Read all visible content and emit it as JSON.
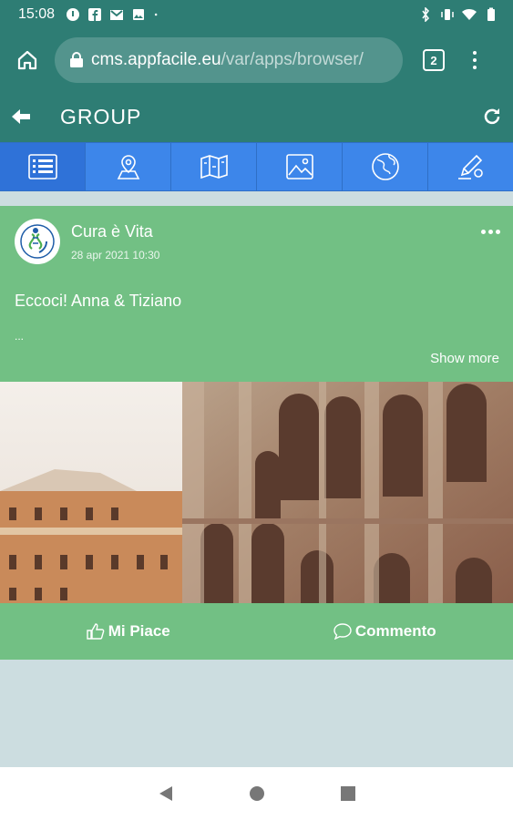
{
  "status_bar": {
    "time": "15:08",
    "left_icons": [
      "info-icon",
      "facebook-icon",
      "gmail-icon",
      "image-icon",
      "dot-icon"
    ],
    "right_icons": [
      "bluetooth-icon",
      "vibrate-icon",
      "wifi-icon",
      "battery-icon"
    ]
  },
  "browser": {
    "url_host": "cms.appfacile.eu",
    "url_path": "/var/apps/browser/",
    "tab_count": "2"
  },
  "app_header": {
    "title": "GROUP"
  },
  "tabs": [
    {
      "icon": "list-icon",
      "active": true
    },
    {
      "icon": "map-pin-icon",
      "active": false
    },
    {
      "icon": "map-icon",
      "active": false
    },
    {
      "icon": "image-gallery-icon",
      "active": false
    },
    {
      "icon": "globe-icon",
      "active": false
    },
    {
      "icon": "pencil-icon",
      "active": false
    }
  ],
  "post": {
    "author": "Cura è Vita",
    "timestamp": "28 apr 2021 10:30",
    "text": "Eccoci! Anna & Tiziano",
    "ellipsis": "...",
    "show_more": "Show more",
    "like_label": "Mi Piace",
    "comment_label": "Commento"
  },
  "colors": {
    "header_teal": "#2e7d74",
    "tab_blue": "#3d86ea",
    "card_green": "#72c084",
    "page_bg": "#ccdde0"
  }
}
